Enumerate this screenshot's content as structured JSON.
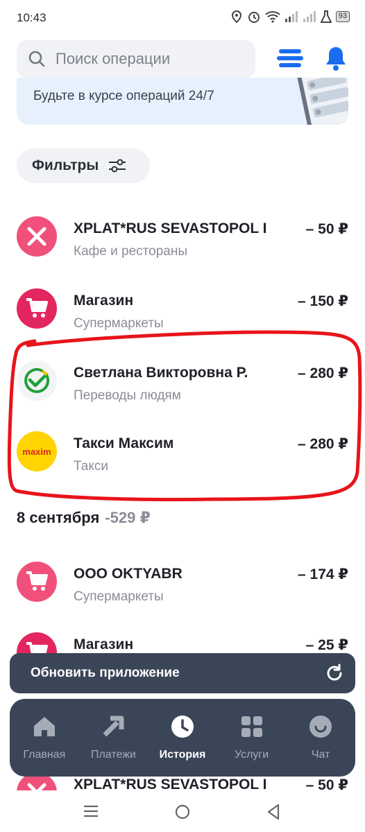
{
  "status_bar": {
    "time": "10:43",
    "battery": "93"
  },
  "search": {
    "placeholder": "Поиск операции"
  },
  "banner": {
    "text": "Будьте в курсе операций 24/7"
  },
  "filters": {
    "label": "Фильтры"
  },
  "transactions": [
    {
      "name": "XPLAT*RUS SEVASTOPOL I",
      "category": "Кафе и рестораны",
      "amount": "– 50 ₽",
      "icon": "fork-knife-icon",
      "color": "#f0507a"
    },
    {
      "name": "Магазин",
      "category": "Супермаркеты",
      "amount": "– 150 ₽",
      "icon": "cart-icon",
      "color": "#e3265f"
    },
    {
      "name": "Светлана Викторовна Р.",
      "category": "Переводы людям",
      "amount": "– 280 ₽",
      "icon": "sber-check-icon",
      "color": "#f2f4f5"
    },
    {
      "name": "Такси Максим",
      "category": "Такси",
      "amount": "– 280 ₽",
      "icon": "maxim-logo",
      "color": "#ffd400"
    }
  ],
  "date_group": {
    "date": "8 сентября",
    "total": "-529 ₽"
  },
  "transactions2": [
    {
      "name": "ООО OKTYABR",
      "category": "Супермаркеты",
      "amount": "– 174 ₽",
      "icon": "cart-icon",
      "color": "#f0507a"
    },
    {
      "name": "Магазин",
      "category": "",
      "amount": "– 25 ₽",
      "icon": "cart-icon",
      "color": "#e3265f"
    },
    {
      "name": "XPLAT*RUS SEVASTOPOL I",
      "category": "",
      "amount": "– 50 ₽",
      "icon": "fork-knife-icon",
      "color": "#f0507a"
    }
  ],
  "maxim_logo_text": "maxim",
  "toast": {
    "label": "Обновить приложение"
  },
  "bottom_nav": [
    {
      "label": "Главная",
      "icon": "home-icon",
      "active": false
    },
    {
      "label": "Платежи",
      "icon": "arrow-icon",
      "active": false
    },
    {
      "label": "История",
      "icon": "clock-icon",
      "active": true
    },
    {
      "label": "Услуги",
      "icon": "grid-icon",
      "active": false
    },
    {
      "label": "Чат",
      "icon": "chat-icon",
      "active": false
    }
  ],
  "colors": {
    "accent": "#1a6df0",
    "nav_bg": "#3a4557",
    "annotation": "#e8141b"
  }
}
